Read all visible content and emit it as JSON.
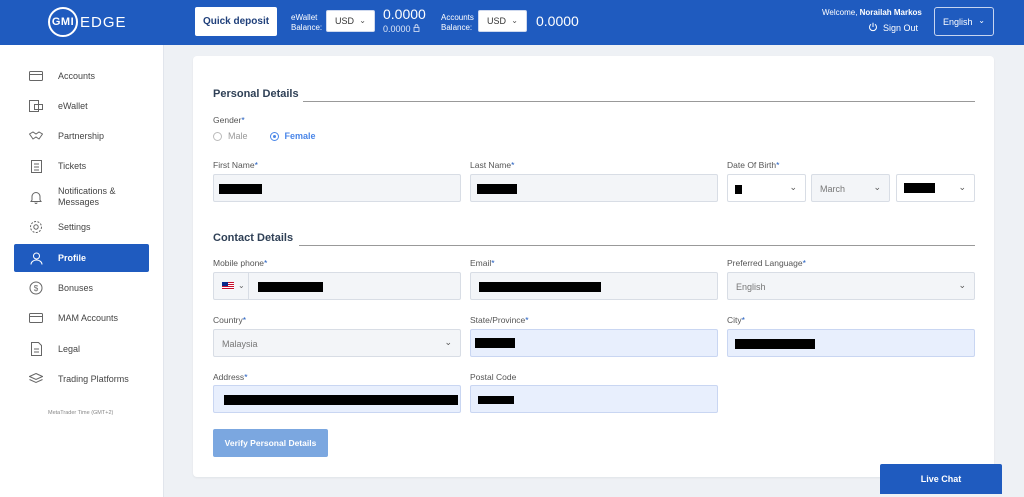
{
  "header": {
    "logo_left": "GMI",
    "logo_right": "EDGE",
    "quick_deposit": "Quick deposit",
    "ewallet_label_1": "eWallet",
    "ewallet_label_2": "Balance:",
    "ewallet_currency": "USD",
    "ewallet_value": "0.0000",
    "ewallet_sub": "0.0000",
    "accounts_label_1": "Accounts",
    "accounts_label_2": "Balance:",
    "accounts_currency": "USD",
    "accounts_value": "0.0000",
    "welcome_prefix": "Welcome, ",
    "welcome_name": "Norailah Markos",
    "sign_out": "Sign Out",
    "language": "English"
  },
  "sidebar": {
    "items": [
      {
        "label": "Accounts",
        "icon": "card-icon"
      },
      {
        "label": "eWallet",
        "icon": "wallet-icon"
      },
      {
        "label": "Partnership",
        "icon": "handshake-icon"
      },
      {
        "label": "Tickets",
        "icon": "clipboard-icon"
      },
      {
        "label_1": "Notifications &",
        "label_2": "Messages",
        "icon": "bell-icon"
      },
      {
        "label": "Settings",
        "icon": "gear-icon"
      },
      {
        "label": "Profile",
        "icon": "user-icon"
      },
      {
        "label": "Bonuses",
        "icon": "dollar-icon"
      },
      {
        "label": "MAM Accounts",
        "icon": "card-icon"
      },
      {
        "label": "Legal",
        "icon": "document-icon"
      },
      {
        "label": "Trading Platforms",
        "icon": "layers-icon"
      }
    ],
    "active_index": 6,
    "metatrader_time": "MetaTrader Time (GMT+2)"
  },
  "personal": {
    "title": "Personal Details",
    "gender_label": "Gender",
    "gender_male": "Male",
    "gender_female": "Female",
    "gender_selected": "Female",
    "first_name_label": "First Name",
    "last_name_label": "Last Name",
    "dob_label": "Date Of Birth",
    "dob_month": "March"
  },
  "contact": {
    "title": "Contact Details",
    "mobile_label": "Mobile phone",
    "email_label": "Email",
    "pref_lang_label": "Preferred Language",
    "pref_lang_value": "English",
    "country_label": "Country",
    "country_value": "Malaysia",
    "state_label": "State/Province",
    "city_label": "City",
    "address_label": "Address",
    "postal_label": "Postal Code"
  },
  "required_mark": "*",
  "verify_button": "Verify Personal Details",
  "live_chat": "Live Chat",
  "colors": {
    "brand": "#1f5bbf",
    "accent": "#4a86e8",
    "verify_disabled": "#7ba7e0"
  }
}
